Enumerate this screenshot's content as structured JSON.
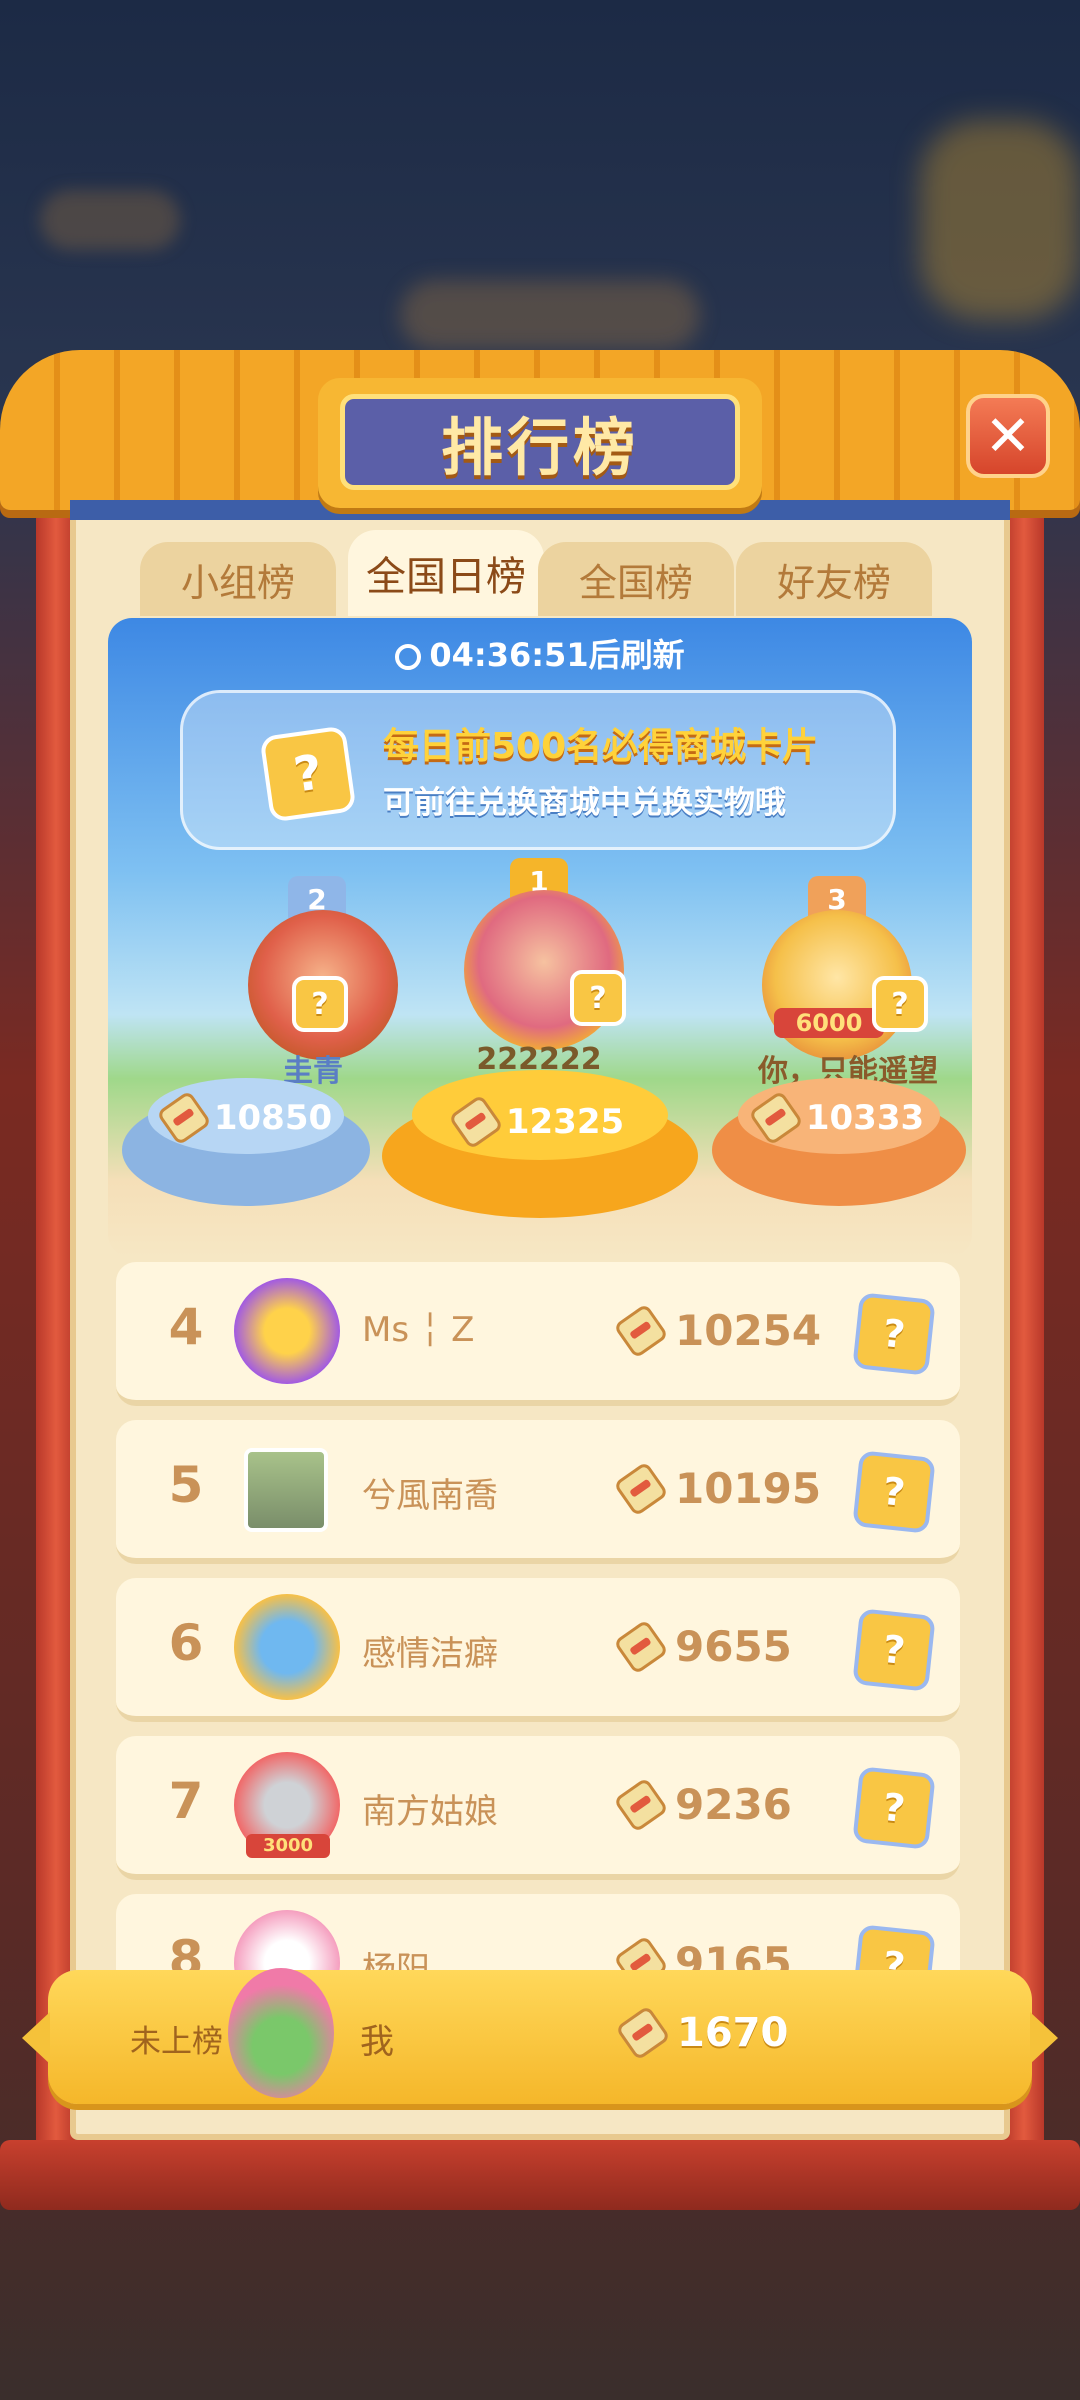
{
  "title": "排行榜",
  "close_symbol": "✕",
  "tabs": [
    {
      "label": "小组榜"
    },
    {
      "label": "全国日榜"
    },
    {
      "label": "全国榜"
    },
    {
      "label": "好友榜"
    }
  ],
  "banner": {
    "refresh_text": "04:36:51后刷新",
    "line1": "每日前500名必得商城卡片",
    "line2": "可前往兑换商城中兑换实物哦",
    "card_symbol": "?"
  },
  "podium": [
    {
      "rank": "2",
      "name": "圭青",
      "score": "10850"
    },
    {
      "rank": "1",
      "name": "222222",
      "score": "12325"
    },
    {
      "rank": "3",
      "name": "你，只能遥望",
      "score": "10333",
      "badge": "6000"
    }
  ],
  "list": [
    {
      "rank": "4",
      "name": "Ms ╎ Z",
      "score": "10254"
    },
    {
      "rank": "5",
      "name": "兮風南喬",
      "score": "10195"
    },
    {
      "rank": "6",
      "name": "感情洁癖",
      "score": "9655"
    },
    {
      "rank": "7",
      "name": "南方姑娘",
      "score": "9236",
      "badge": "3000"
    },
    {
      "rank": "8",
      "name": "杨阳",
      "score": "9165"
    }
  ],
  "me": {
    "rank_text": "未上榜",
    "name": "我",
    "score": "1670"
  },
  "colors": {
    "accent": "#f5b72a",
    "title_bg": "#5b5fa8",
    "pillar": "#e25a3e"
  }
}
